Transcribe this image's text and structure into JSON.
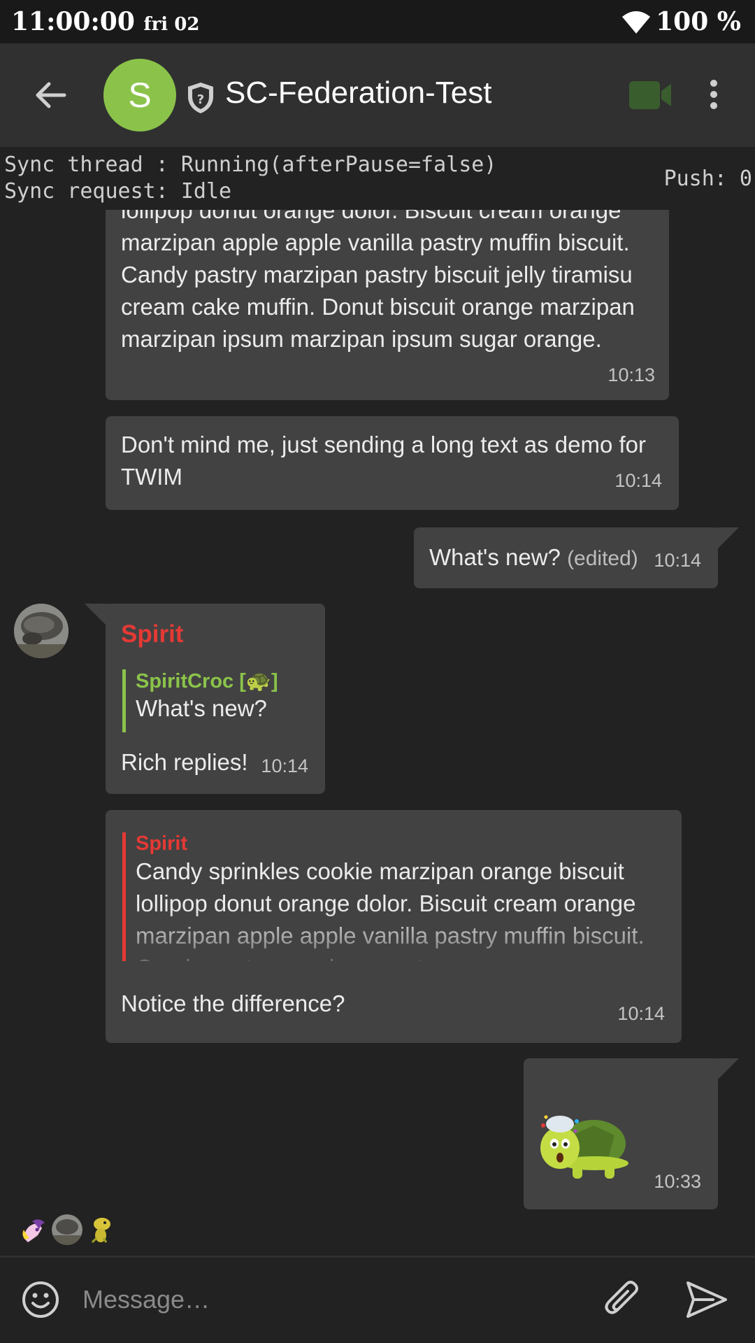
{
  "status_bar": {
    "time": "11:00:00",
    "day": "fri 02",
    "battery": "100 %",
    "wifi_icon": "wifi-icon"
  },
  "header": {
    "back_icon": "arrow-back-icon",
    "room_avatar_letter": "S",
    "room_avatar_color": "#8bc34a",
    "shield_icon": "shield-unknown-icon",
    "room_name": "SC-Federation-Test",
    "video_icon": "video-call-icon",
    "overflow_icon": "more-vert-icon"
  },
  "debug": {
    "sync_thread": "Sync thread : Running(afterPause=false)",
    "sync_request": "Sync request: Idle",
    "push": "Push: 0"
  },
  "messages": [
    {
      "text": "lollipop donut orange dolor. Biscuit cream orange marzipan apple apple vanilla pastry muffin biscuit. Candy pastry marzipan pastry biscuit jelly tiramisu cream cake muffin. Donut biscuit orange marzipan marzipan ipsum marzipan ipsum sugar orange.",
      "time": "10:13"
    },
    {
      "text": "Don't mind me, just sending a long text as demo for TWIM",
      "time": "10:14"
    },
    {
      "text": "What's new?",
      "edited": "(edited)",
      "time": "10:14"
    },
    {
      "sender": "Spirit",
      "sender_color": "#e53935",
      "reply_to_name": "SpiritCroc [🐢]",
      "reply_to_text": "What's new?",
      "text": "Rich replies!",
      "time": "10:14"
    },
    {
      "reply_to_name": "Spirit",
      "reply_to_text": "Candy sprinkles cookie marzipan orange biscuit lollipop donut orange dolor. Biscuit cream orange marzipan apple apple vanilla pastry muffin biscuit. Candy pastry marzipan pastry",
      "text": "Notice the difference?",
      "time": "10:14"
    },
    {
      "sticker": "turtle-sticker",
      "time": "10:33"
    }
  ],
  "read_receipts": [
    "pony-avatar",
    "turtle-photo-avatar",
    "croc-avatar"
  ],
  "composer": {
    "emoji_icon": "emoji-icon",
    "placeholder": "Message…",
    "attach_icon": "paperclip-icon",
    "send_icon": "send-icon"
  },
  "colors": {
    "accent_green": "#8bc34a",
    "sender_red": "#e53935",
    "bubble": "#424242",
    "background": "#222222"
  }
}
